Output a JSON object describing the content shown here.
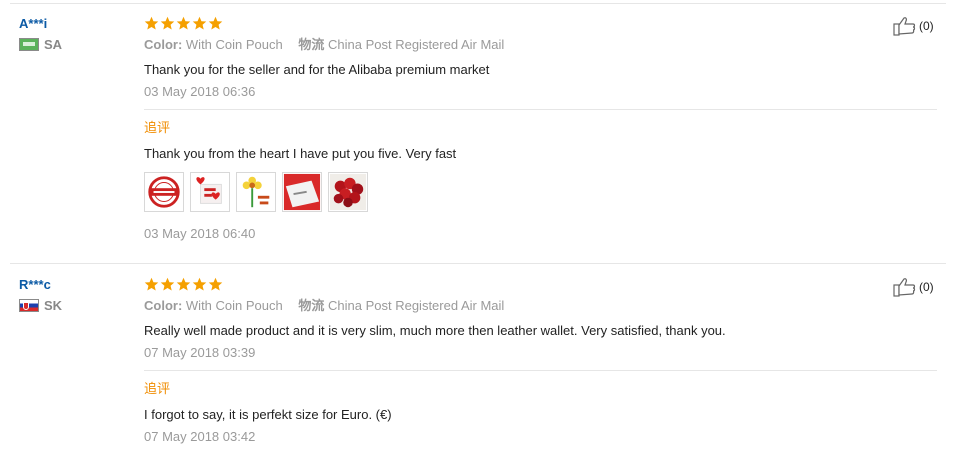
{
  "reviews": [
    {
      "user_name": "A***i",
      "country_code": "SA",
      "rating": 5,
      "color_label": "Color:",
      "color_value": "With Coin Pouch",
      "shipping_label": "物流",
      "shipping_value": "China Post Registered Air Mail",
      "text": "Thank you for the seller and for the Alibaba premium market",
      "date": "03 May 2018 06:36",
      "helpful_count": "(0)",
      "followup": {
        "label": "追评",
        "text": "Thank you from the heart I have put you five. Very fast",
        "date": "03 May 2018 06:40",
        "photos": [
          "thank-you-stamp",
          "thank-you-hearts",
          "thank-you-flower",
          "thank-you-card",
          "red-roses"
        ]
      }
    },
    {
      "user_name": "R***c",
      "country_code": "SK",
      "rating": 5,
      "color_label": "Color:",
      "color_value": "With Coin Pouch",
      "shipping_label": "物流",
      "shipping_value": "China Post Registered Air Mail",
      "text": "Really well made product and it is very slim, much more then leather wallet. Very satisfied, thank you.",
      "date": "07 May 2018 03:39",
      "helpful_count": "(0)",
      "followup": {
        "label": "追评",
        "text": "I forgot to say, it is perfekt size for Euro. (€)",
        "date": "07 May 2018 03:42",
        "photos": []
      }
    }
  ],
  "colors": {
    "star": "#f5a000",
    "username": "#0b5aa5",
    "followup_label": "#f08c00",
    "muted": "#9a9a9a"
  }
}
